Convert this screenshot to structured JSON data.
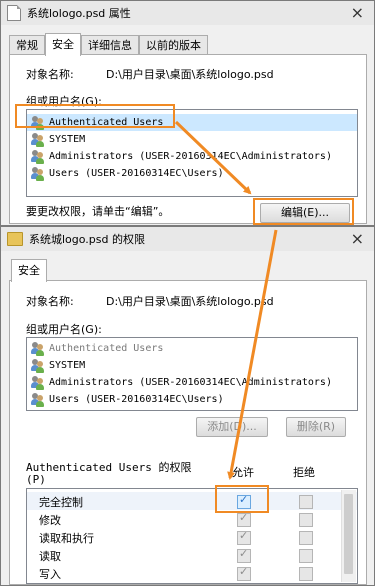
{
  "props_dialog": {
    "title": "系统lologo.psd 属性",
    "close": "×",
    "tabs": [
      "常规",
      "安全",
      "详细信息",
      "以前的版本"
    ],
    "object_label": "对象名称:",
    "object_value": "D:\\用户目录\\桌面\\系统lologo.psd",
    "group_label": "组或用户名(G):",
    "users": [
      "Authenticated Users",
      "SYSTEM",
      "Administrators (USER-20160314EC\\Administrators)",
      "Users (USER-20160314EC\\Users)"
    ],
    "edit_hint": "要更改权限，请单击“编辑”。",
    "edit_button": "编辑(E)..."
  },
  "perm_dialog": {
    "title": "系统城logo.psd 的权限",
    "close": "×",
    "tab": "安全",
    "object_label": "对象名称:",
    "object_value": "D:\\用户目录\\桌面\\系统lologo.psd",
    "group_label": "组或用户名(G):",
    "users": [
      "Authenticated Users",
      "SYSTEM",
      "Administrators (USER-20160314EC\\Administrators)",
      "Users (USER-20160314EC\\Users)"
    ],
    "add_button": "添加(D)...",
    "remove_button": "删除(R)",
    "perms_label_line1": "Authenticated Users 的权限",
    "perms_label_line2": "(P)",
    "allow_header": "允许",
    "deny_header": "拒绝",
    "permissions": [
      {
        "name": "完全控制",
        "allow": true,
        "deny": false
      },
      {
        "name": "修改",
        "allow": true,
        "deny": false
      },
      {
        "name": "读取和执行",
        "allow": true,
        "deny": false
      },
      {
        "name": "读取",
        "allow": true,
        "deny": false
      },
      {
        "name": "写入",
        "allow": true,
        "deny": false
      }
    ]
  },
  "colors": {
    "annotation": "#f08a24",
    "selection": "#cce8ff"
  }
}
